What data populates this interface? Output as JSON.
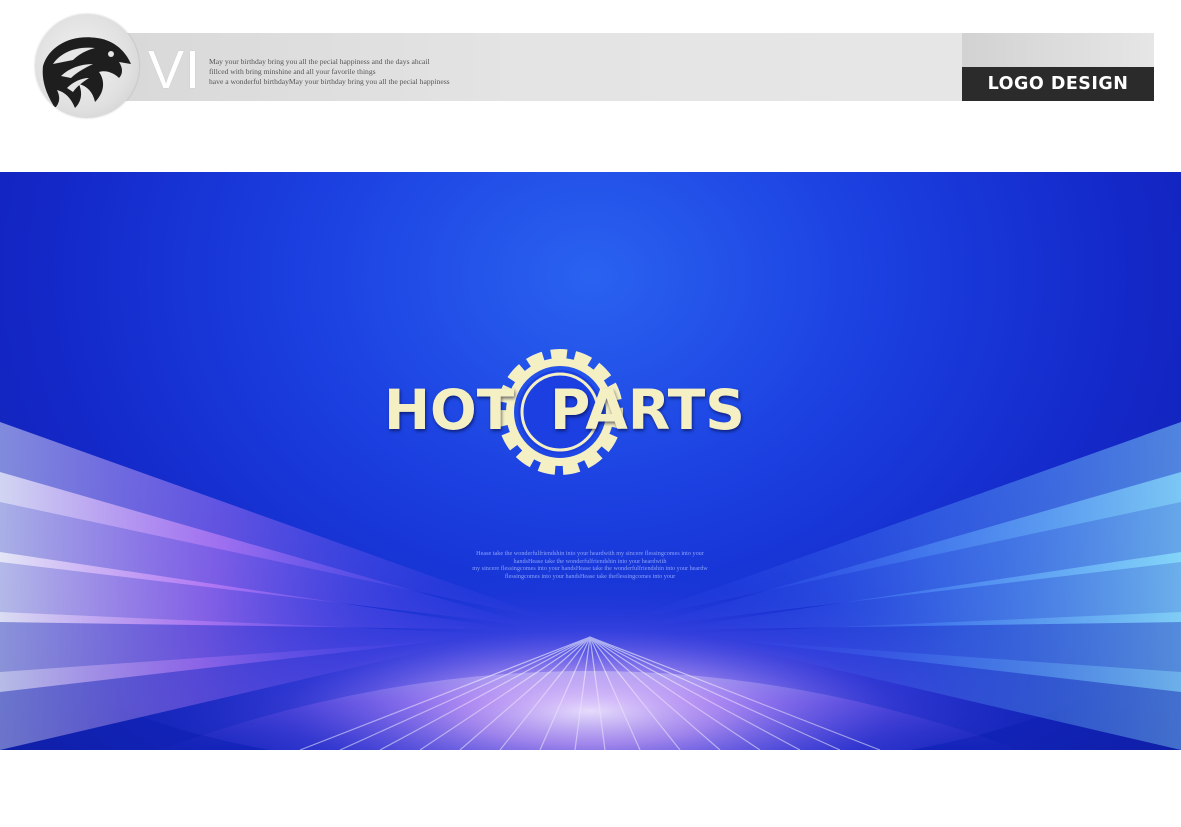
{
  "header": {
    "emblem_icon": "eagle-head-icon",
    "vi_label": "VI",
    "blurb_lines": [
      "May your birthday bring you all the pecial happiness and  the days ahcail",
      "fillced with bring  minshine and all your favorile things",
      "have a wonderful birthdayMay your birthday bring you all the pecial happiness"
    ],
    "tag_label": "LOGO DESIGN"
  },
  "hero": {
    "brand_left": "HOT",
    "brand_right": "PARTS",
    "brand_icon": "gear-icon",
    "brand_color": "#f4f0c4",
    "background_color": "#1b3fe0",
    "tagline_lines": [
      "Hease take the wonderfulfriendshin into your heardwith my sincere flessingcomes into your",
      "handsHease take the wonderfulfriendshin into your heardwith",
      "my sincere flessingcomes into your handsHease take the wonderfulfriendshin into your heardw",
      "flessingcomes into your handsHease take theflessingcomes into your"
    ]
  }
}
